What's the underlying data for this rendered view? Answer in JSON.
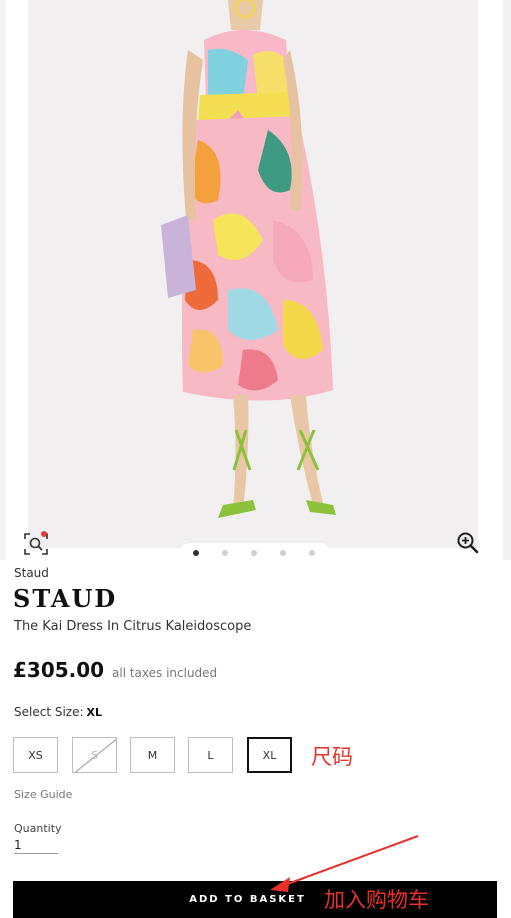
{
  "gallery": {
    "image_icon_names": [
      "visual-search-icon",
      "zoom-in-icon"
    ],
    "dot_count": 5,
    "active_dot": 0
  },
  "product": {
    "brand_small": "Staud",
    "brand_large": "STAUD",
    "name": "The Kai Dress In Citrus Kaleidoscope",
    "price": "£305.00",
    "tax_note": "all taxes included"
  },
  "size_selector": {
    "label": "Select Size:",
    "selected_value": "XL",
    "options": [
      {
        "label": "XS",
        "available": true,
        "selected": false
      },
      {
        "label": "S",
        "available": false,
        "selected": false
      },
      {
        "label": "M",
        "available": true,
        "selected": false
      },
      {
        "label": "L",
        "available": true,
        "selected": false
      },
      {
        "label": "XL",
        "available": true,
        "selected": true
      }
    ],
    "size_guide": "Size Guide"
  },
  "quantity": {
    "label": "Quantity",
    "value": "1"
  },
  "cta": {
    "add_to_basket": "ADD TO BASKET"
  },
  "annotations": {
    "size_note": "尺码",
    "basket_note": "加入购物车",
    "color": "#e8312a"
  },
  "colors": {
    "button_bg": "#000000",
    "photo_bg": "#f1efef"
  }
}
